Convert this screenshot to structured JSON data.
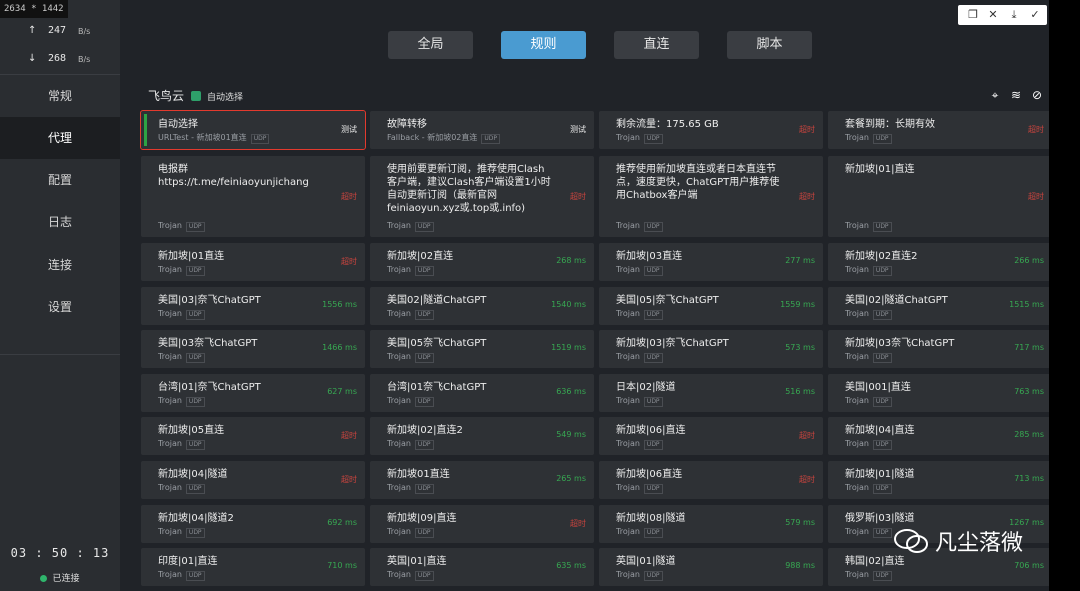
{
  "screen_label": "2634 * 1442",
  "speed": {
    "up_arrow": "↑",
    "up_value": "247",
    "up_unit": "B/s",
    "down_arrow": "↓",
    "down_value": "268",
    "down_unit": "B/s"
  },
  "nav": [
    {
      "label": "常规"
    },
    {
      "label": "代理"
    },
    {
      "label": "配置"
    },
    {
      "label": "日志"
    },
    {
      "label": "连接"
    },
    {
      "label": "设置"
    }
  ],
  "status": {
    "timer": "03 : 50 : 13",
    "connected": "已连接"
  },
  "modes": [
    {
      "label": "全局"
    },
    {
      "label": "规则"
    },
    {
      "label": "直连"
    },
    {
      "label": "脚本"
    }
  ],
  "group": {
    "name": "飞鸟云",
    "selected": "自动选择"
  },
  "watermark": {
    "text": "凡尘落微"
  },
  "colors": {
    "accent": "#4a9bd1",
    "ok": "#37a852",
    "timeout": "#c8443e",
    "selected_border": "#e33a2e"
  },
  "proxies": [
    {
      "name": "自动选择",
      "sub": "URLTest - 新加坡01直连",
      "tag": "UDP",
      "latency": "测试",
      "kind": "test",
      "sel": true
    },
    {
      "name": "故障转移",
      "sub": "Fallback - 新加坡02直连",
      "tag": "UDP",
      "latency": "测试",
      "kind": "test"
    },
    {
      "name": "剩余流量：175.65 GB",
      "sub": "Trojan",
      "tag": "UDP",
      "latency": "超时",
      "kind": "to"
    },
    {
      "name": "套餐到期：长期有效",
      "sub": "Trojan",
      "tag": "UDP",
      "latency": "超时",
      "kind": "to"
    },
    {
      "name": "电报群https://t.me/feiniaoyunjichang",
      "sub": "Trojan",
      "tag": "UDP",
      "latency": "超时",
      "kind": "to"
    },
    {
      "name": "使用前要更新订阅，推荐使用Clash客户端，建议Clash客户端设置1小时自动更新订阅（最新官网feiniaoyun.xyz或.top或.info)",
      "sub": "Trojan",
      "tag": "UDP",
      "latency": "超时",
      "kind": "to"
    },
    {
      "name": "推荐使用新加坡直连或者日本直连节点，速度更快，ChatGPT用户推荐使用Chatbox客户端",
      "sub": "Trojan",
      "tag": "UDP",
      "latency": "超时",
      "kind": "to"
    },
    {
      "name": "新加坡|01|直连",
      "sub": "Trojan",
      "tag": "UDP",
      "latency": "超时",
      "kind": "to"
    },
    {
      "name": "新加坡|01直连",
      "sub": "Trojan",
      "tag": "UDP",
      "latency": "超时",
      "kind": "to"
    },
    {
      "name": "新加坡|02直连",
      "sub": "Trojan",
      "tag": "UDP",
      "latency": "268 ms",
      "kind": "ok"
    },
    {
      "name": "新加坡|03直连",
      "sub": "Trojan",
      "tag": "UDP",
      "latency": "277 ms",
      "kind": "ok"
    },
    {
      "name": "新加坡|02直连2",
      "sub": "Trojan",
      "tag": "UDP",
      "latency": "266 ms",
      "kind": "ok"
    },
    {
      "name": "美国|03|奈飞ChatGPT",
      "sub": "Trojan",
      "tag": "UDP",
      "latency": "1556 ms",
      "kind": "ok"
    },
    {
      "name": "美国02|隧道ChatGPT",
      "sub": "Trojan",
      "tag": "UDP",
      "latency": "1540 ms",
      "kind": "ok"
    },
    {
      "name": "美国|05|奈飞ChatGPT",
      "sub": "Trojan",
      "tag": "UDP",
      "latency": "1559 ms",
      "kind": "ok"
    },
    {
      "name": "美国|02|隧道ChatGPT",
      "sub": "Trojan",
      "tag": "UDP",
      "latency": "1515 ms",
      "kind": "ok"
    },
    {
      "name": "美国|03奈飞ChatGPT",
      "sub": "Trojan",
      "tag": "UDP",
      "latency": "1466 ms",
      "kind": "ok"
    },
    {
      "name": "美国|05奈飞ChatGPT",
      "sub": "Trojan",
      "tag": "UDP",
      "latency": "1519 ms",
      "kind": "ok"
    },
    {
      "name": "新加坡|03|奈飞ChatGPT",
      "sub": "Trojan",
      "tag": "UDP",
      "latency": "573 ms",
      "kind": "ok"
    },
    {
      "name": "新加坡|03奈飞ChatGPT",
      "sub": "Trojan",
      "tag": "UDP",
      "latency": "717 ms",
      "kind": "ok"
    },
    {
      "name": "台湾|01|奈飞ChatGPT",
      "sub": "Trojan",
      "tag": "UDP",
      "latency": "627 ms",
      "kind": "ok"
    },
    {
      "name": "台湾|01奈飞ChatGPT",
      "sub": "Trojan",
      "tag": "UDP",
      "latency": "636 ms",
      "kind": "ok"
    },
    {
      "name": "日本|02|隧道",
      "sub": "Trojan",
      "tag": "UDP",
      "latency": "516 ms",
      "kind": "ok"
    },
    {
      "name": "美国|001|直连",
      "sub": "Trojan",
      "tag": "UDP",
      "latency": "763 ms",
      "kind": "ok"
    },
    {
      "name": "新加坡|05直连",
      "sub": "Trojan",
      "tag": "UDP",
      "latency": "超时",
      "kind": "to"
    },
    {
      "name": "新加坡|02|直连2",
      "sub": "Trojan",
      "tag": "UDP",
      "latency": "549 ms",
      "kind": "ok"
    },
    {
      "name": "新加坡|06|直连",
      "sub": "Trojan",
      "tag": "UDP",
      "latency": "超时",
      "kind": "to"
    },
    {
      "name": "新加坡|04|直连",
      "sub": "Trojan",
      "tag": "UDP",
      "latency": "285 ms",
      "kind": "ok"
    },
    {
      "name": "新加坡|04|隧道",
      "sub": "Trojan",
      "tag": "UDP",
      "latency": "超时",
      "kind": "to"
    },
    {
      "name": "新加坡01直连",
      "sub": "Trojan",
      "tag": "UDP",
      "latency": "265 ms",
      "kind": "ok"
    },
    {
      "name": "新加坡|06直连",
      "sub": "Trojan",
      "tag": "UDP",
      "latency": "超时",
      "kind": "to"
    },
    {
      "name": "新加坡|01|隧道",
      "sub": "Trojan",
      "tag": "UDP",
      "latency": "713 ms",
      "kind": "ok"
    },
    {
      "name": "新加坡|04|隧道2",
      "sub": "Trojan",
      "tag": "UDP",
      "latency": "692 ms",
      "kind": "ok"
    },
    {
      "name": "新加坡|09|直连",
      "sub": "Trojan",
      "tag": "UDP",
      "latency": "超时",
      "kind": "to"
    },
    {
      "name": "新加坡|08|隧道",
      "sub": "Trojan",
      "tag": "UDP",
      "latency": "579 ms",
      "kind": "ok"
    },
    {
      "name": "俄罗斯|03|隧道",
      "sub": "Trojan",
      "tag": "UDP",
      "latency": "1267 ms",
      "kind": "ok"
    },
    {
      "name": "印度|01|直连",
      "sub": "Trojan",
      "tag": "UDP",
      "latency": "710 ms",
      "kind": "ok"
    },
    {
      "name": "英国|01|直连",
      "sub": "Trojan",
      "tag": "UDP",
      "latency": "635 ms",
      "kind": "ok"
    },
    {
      "name": "英国|01|隧道",
      "sub": "Trojan",
      "tag": "UDP",
      "latency": "988 ms",
      "kind": "ok"
    },
    {
      "name": "韩国|02|直连",
      "sub": "Trojan",
      "tag": "UDP",
      "latency": "706 ms",
      "kind": "ok"
    }
  ]
}
